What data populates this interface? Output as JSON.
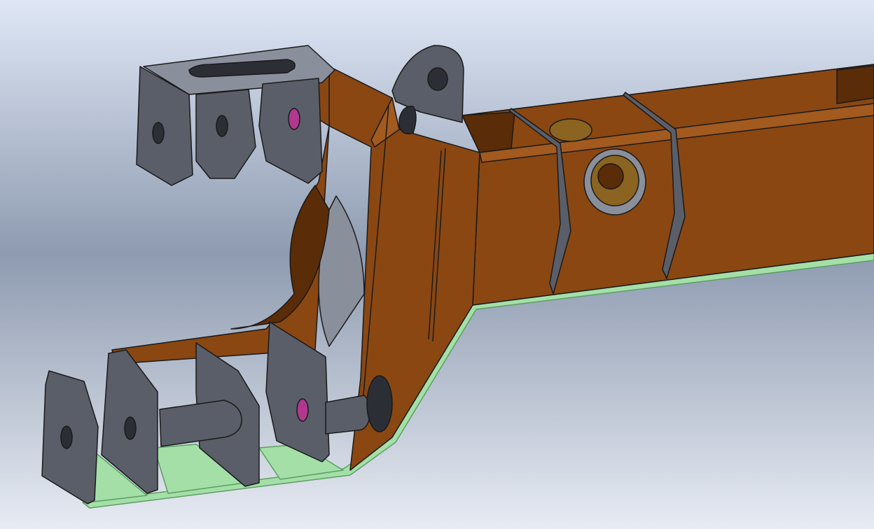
{
  "viewport": {
    "background_top": "#dfe7f6",
    "background_mid": "#8e9bb0",
    "background_bottom": "#e7ebf3"
  },
  "colors": {
    "frame_body": "#8a4712",
    "frame_shadow": "#5a2c07",
    "frame_light": "#a35a1e",
    "bracket_steel": "#5a5e68",
    "bracket_dark": "#2b2e35",
    "bracket_light": "#8a8f9c",
    "base_plate": "#a5dfa8",
    "base_plate_edge": "#5a9f62",
    "bushing_brass": "#8a6420",
    "outline": "#1a1a1a",
    "hole_highlight": "#b0388f"
  }
}
